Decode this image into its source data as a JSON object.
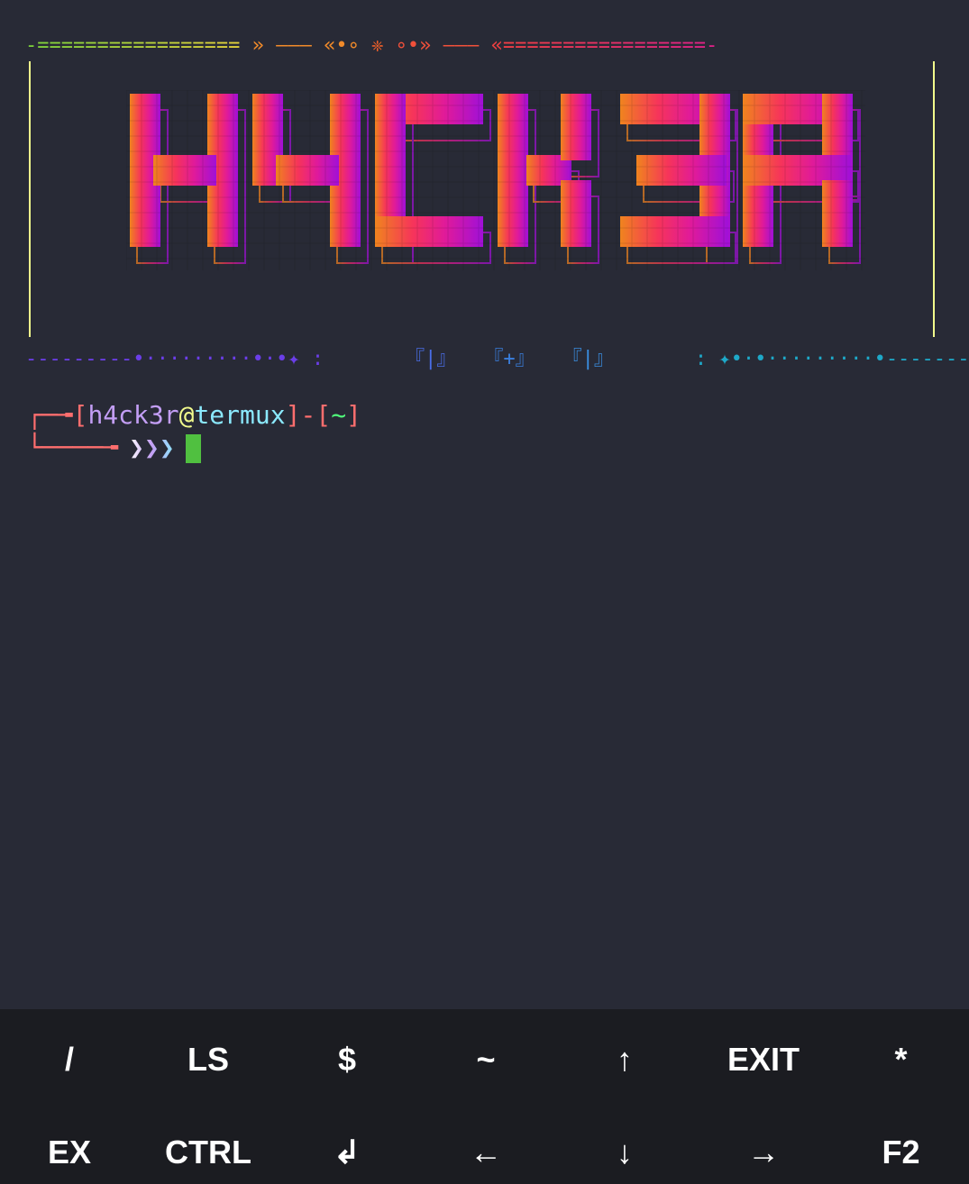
{
  "banner": {
    "top_decoration": {
      "left": "-=================",
      "mid1": " » ——— «•∘ ",
      "center": "❈",
      "mid2": " ∘•» ——— ",
      "right": "«=================-"
    },
    "logo_text": "H4CK3R",
    "bottom_decoration": {
      "left": "---------•·········•·•✦ :",
      "seg1": "『|』",
      "seg2": "『+』",
      "seg3": "『|』",
      "right": ": ✦•·•·········•---------"
    }
  },
  "prompt": {
    "corner_top": "┌─╼",
    "open_bracket": "[",
    "user": "h4ck3r",
    "at": "@",
    "host": "termux",
    "close_bracket": "]",
    "separator": "-",
    "dir_open": "[",
    "dir": "~",
    "dir_close": "]",
    "corner_bottom": "└────╼",
    "arrows": "❯❯❯"
  },
  "extra_keys": {
    "row1": [
      "/",
      "LS",
      "$",
      "~",
      "↑",
      "EXIT",
      "*"
    ],
    "row2": [
      "EX",
      "CTRL",
      "↲",
      "←",
      "↓",
      "→",
      "F2"
    ]
  },
  "colors": {
    "background": "#282a36",
    "keybar": "#1b1c21",
    "cursor": "#50c040",
    "frame": "#f1fa8c"
  }
}
